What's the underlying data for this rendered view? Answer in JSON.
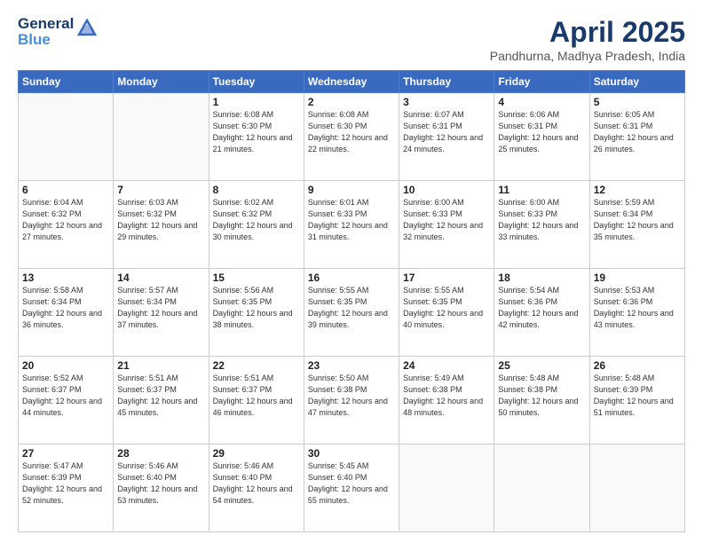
{
  "logo": {
    "line1": "General",
    "line2": "Blue",
    "icon": "▶"
  },
  "title": "April 2025",
  "subtitle": "Pandhurna, Madhya Pradesh, India",
  "weekdays": [
    "Sunday",
    "Monday",
    "Tuesday",
    "Wednesday",
    "Thursday",
    "Friday",
    "Saturday"
  ],
  "days": [
    {
      "date": "",
      "sunrise": "",
      "sunset": "",
      "daylight": ""
    },
    {
      "date": "",
      "sunrise": "",
      "sunset": "",
      "daylight": ""
    },
    {
      "date": "1",
      "sunrise": "Sunrise: 6:08 AM",
      "sunset": "Sunset: 6:30 PM",
      "daylight": "Daylight: 12 hours and 21 minutes."
    },
    {
      "date": "2",
      "sunrise": "Sunrise: 6:08 AM",
      "sunset": "Sunset: 6:30 PM",
      "daylight": "Daylight: 12 hours and 22 minutes."
    },
    {
      "date": "3",
      "sunrise": "Sunrise: 6:07 AM",
      "sunset": "Sunset: 6:31 PM",
      "daylight": "Daylight: 12 hours and 24 minutes."
    },
    {
      "date": "4",
      "sunrise": "Sunrise: 6:06 AM",
      "sunset": "Sunset: 6:31 PM",
      "daylight": "Daylight: 12 hours and 25 minutes."
    },
    {
      "date": "5",
      "sunrise": "Sunrise: 6:05 AM",
      "sunset": "Sunset: 6:31 PM",
      "daylight": "Daylight: 12 hours and 26 minutes."
    },
    {
      "date": "6",
      "sunrise": "Sunrise: 6:04 AM",
      "sunset": "Sunset: 6:32 PM",
      "daylight": "Daylight: 12 hours and 27 minutes."
    },
    {
      "date": "7",
      "sunrise": "Sunrise: 6:03 AM",
      "sunset": "Sunset: 6:32 PM",
      "daylight": "Daylight: 12 hours and 29 minutes."
    },
    {
      "date": "8",
      "sunrise": "Sunrise: 6:02 AM",
      "sunset": "Sunset: 6:32 PM",
      "daylight": "Daylight: 12 hours and 30 minutes."
    },
    {
      "date": "9",
      "sunrise": "Sunrise: 6:01 AM",
      "sunset": "Sunset: 6:33 PM",
      "daylight": "Daylight: 12 hours and 31 minutes."
    },
    {
      "date": "10",
      "sunrise": "Sunrise: 6:00 AM",
      "sunset": "Sunset: 6:33 PM",
      "daylight": "Daylight: 12 hours and 32 minutes."
    },
    {
      "date": "11",
      "sunrise": "Sunrise: 6:00 AM",
      "sunset": "Sunset: 6:33 PM",
      "daylight": "Daylight: 12 hours and 33 minutes."
    },
    {
      "date": "12",
      "sunrise": "Sunrise: 5:59 AM",
      "sunset": "Sunset: 6:34 PM",
      "daylight": "Daylight: 12 hours and 35 minutes."
    },
    {
      "date": "13",
      "sunrise": "Sunrise: 5:58 AM",
      "sunset": "Sunset: 6:34 PM",
      "daylight": "Daylight: 12 hours and 36 minutes."
    },
    {
      "date": "14",
      "sunrise": "Sunrise: 5:57 AM",
      "sunset": "Sunset: 6:34 PM",
      "daylight": "Daylight: 12 hours and 37 minutes."
    },
    {
      "date": "15",
      "sunrise": "Sunrise: 5:56 AM",
      "sunset": "Sunset: 6:35 PM",
      "daylight": "Daylight: 12 hours and 38 minutes."
    },
    {
      "date": "16",
      "sunrise": "Sunrise: 5:55 AM",
      "sunset": "Sunset: 6:35 PM",
      "daylight": "Daylight: 12 hours and 39 minutes."
    },
    {
      "date": "17",
      "sunrise": "Sunrise: 5:55 AM",
      "sunset": "Sunset: 6:35 PM",
      "daylight": "Daylight: 12 hours and 40 minutes."
    },
    {
      "date": "18",
      "sunrise": "Sunrise: 5:54 AM",
      "sunset": "Sunset: 6:36 PM",
      "daylight": "Daylight: 12 hours and 42 minutes."
    },
    {
      "date": "19",
      "sunrise": "Sunrise: 5:53 AM",
      "sunset": "Sunset: 6:36 PM",
      "daylight": "Daylight: 12 hours and 43 minutes."
    },
    {
      "date": "20",
      "sunrise": "Sunrise: 5:52 AM",
      "sunset": "Sunset: 6:37 PM",
      "daylight": "Daylight: 12 hours and 44 minutes."
    },
    {
      "date": "21",
      "sunrise": "Sunrise: 5:51 AM",
      "sunset": "Sunset: 6:37 PM",
      "daylight": "Daylight: 12 hours and 45 minutes."
    },
    {
      "date": "22",
      "sunrise": "Sunrise: 5:51 AM",
      "sunset": "Sunset: 6:37 PM",
      "daylight": "Daylight: 12 hours and 46 minutes."
    },
    {
      "date": "23",
      "sunrise": "Sunrise: 5:50 AM",
      "sunset": "Sunset: 6:38 PM",
      "daylight": "Daylight: 12 hours and 47 minutes."
    },
    {
      "date": "24",
      "sunrise": "Sunrise: 5:49 AM",
      "sunset": "Sunset: 6:38 PM",
      "daylight": "Daylight: 12 hours and 48 minutes."
    },
    {
      "date": "25",
      "sunrise": "Sunrise: 5:48 AM",
      "sunset": "Sunset: 6:38 PM",
      "daylight": "Daylight: 12 hours and 50 minutes."
    },
    {
      "date": "26",
      "sunrise": "Sunrise: 5:48 AM",
      "sunset": "Sunset: 6:39 PM",
      "daylight": "Daylight: 12 hours and 51 minutes."
    },
    {
      "date": "27",
      "sunrise": "Sunrise: 5:47 AM",
      "sunset": "Sunset: 6:39 PM",
      "daylight": "Daylight: 12 hours and 52 minutes."
    },
    {
      "date": "28",
      "sunrise": "Sunrise: 5:46 AM",
      "sunset": "Sunset: 6:40 PM",
      "daylight": "Daylight: 12 hours and 53 minutes."
    },
    {
      "date": "29",
      "sunrise": "Sunrise: 5:46 AM",
      "sunset": "Sunset: 6:40 PM",
      "daylight": "Daylight: 12 hours and 54 minutes."
    },
    {
      "date": "30",
      "sunrise": "Sunrise: 5:45 AM",
      "sunset": "Sunset: 6:40 PM",
      "daylight": "Daylight: 12 hours and 55 minutes."
    },
    {
      "date": "",
      "sunrise": "",
      "sunset": "",
      "daylight": ""
    },
    {
      "date": "",
      "sunrise": "",
      "sunset": "",
      "daylight": ""
    },
    {
      "date": "",
      "sunrise": "",
      "sunset": "",
      "daylight": ""
    }
  ]
}
